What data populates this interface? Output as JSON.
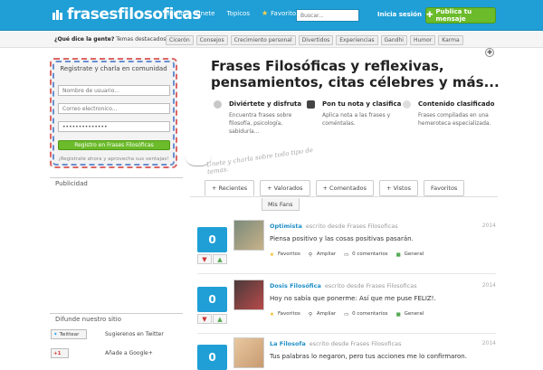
{
  "header": {
    "logo": "frasesfilosoficas",
    "nav": [
      "Inicio",
      "Unete",
      "Topicos"
    ],
    "favoritos": "Favoritos",
    "search_placeholder": "Buscar...",
    "login": "Inicia sesión",
    "publish": "Publica tu mensaje",
    "colors": {
      "bar": "#1f9fd6",
      "publish": "#6bbb2a"
    }
  },
  "tagbar": {
    "question": "¿Qué dice la gente?",
    "label": "Temas destacados",
    "tags": [
      "Cicerón",
      "Consejos",
      "Crecimiento personal",
      "Divertidos",
      "Experiencias",
      "Gandhi",
      "Humor",
      "Karma"
    ]
  },
  "register": {
    "title": "Registrate y charla en comunidad",
    "username": "Nombre de usuario...",
    "email": "Correo electronico...",
    "password": "••••••••••••••",
    "button": "Registro en Frases Filosóficas",
    "footer": "¡Registrate ahora y aprovecha sus ventajas!"
  },
  "sidebar": {
    "publicidad": "Publicidad",
    "difunde": "Difunde nuestro sitio",
    "twitter_badge": "Twittear",
    "twitter_text": "Sugierenos en Twitter",
    "google_badge": "+1",
    "google_text": "Añade a Google+"
  },
  "main": {
    "headline": "Frases Filosóficas y reflexivas, pensamientos, citas célebres y más...",
    "features": [
      {
        "title": "Diviértete y disfruta",
        "text": "Encuentra frases sobre filosofía, psicología, sabiduría..."
      },
      {
        "title": "Pon tu nota y clasifica",
        "text": "Aplica nota a las frases y coméntalas."
      },
      {
        "title": "Contenido clasificado",
        "text": "Frases compiladas en una hemeroteca especializada."
      }
    ],
    "hint": "Unete y charla sobre todo tipo de temas.",
    "tabs": [
      "+ Recientes",
      "+ Valorados",
      "+ Comentados",
      "+ Vistos",
      "Favoritos"
    ],
    "tab_extra": "Mis Fans"
  },
  "posts": [
    {
      "author": "Optimista",
      "meta": "escrito desde Frases Filosoficas",
      "year": "2014",
      "score": "0",
      "text": "Piensa positivo y las cosas positivas pasarán.",
      "actions": [
        "Favoritos",
        "Ampliar",
        "0 comentarios",
        "General"
      ]
    },
    {
      "author": "Dosis Filosófica",
      "meta": "escrito desde Frases Filosoficas",
      "year": "2014",
      "score": "0",
      "text": "Hoy no sabía que ponerme: Así que me puse FELIZ!.",
      "actions": [
        "Favoritos",
        "Ampliar",
        "0 comentarios",
        "General"
      ]
    },
    {
      "author": "La Filosofa",
      "meta": "escrito desde Frases Filosoficas",
      "year": "2014",
      "score": "0",
      "text": "Tus palabras lo negaron, pero tus acciones me lo confirmaron.",
      "actions": []
    }
  ]
}
